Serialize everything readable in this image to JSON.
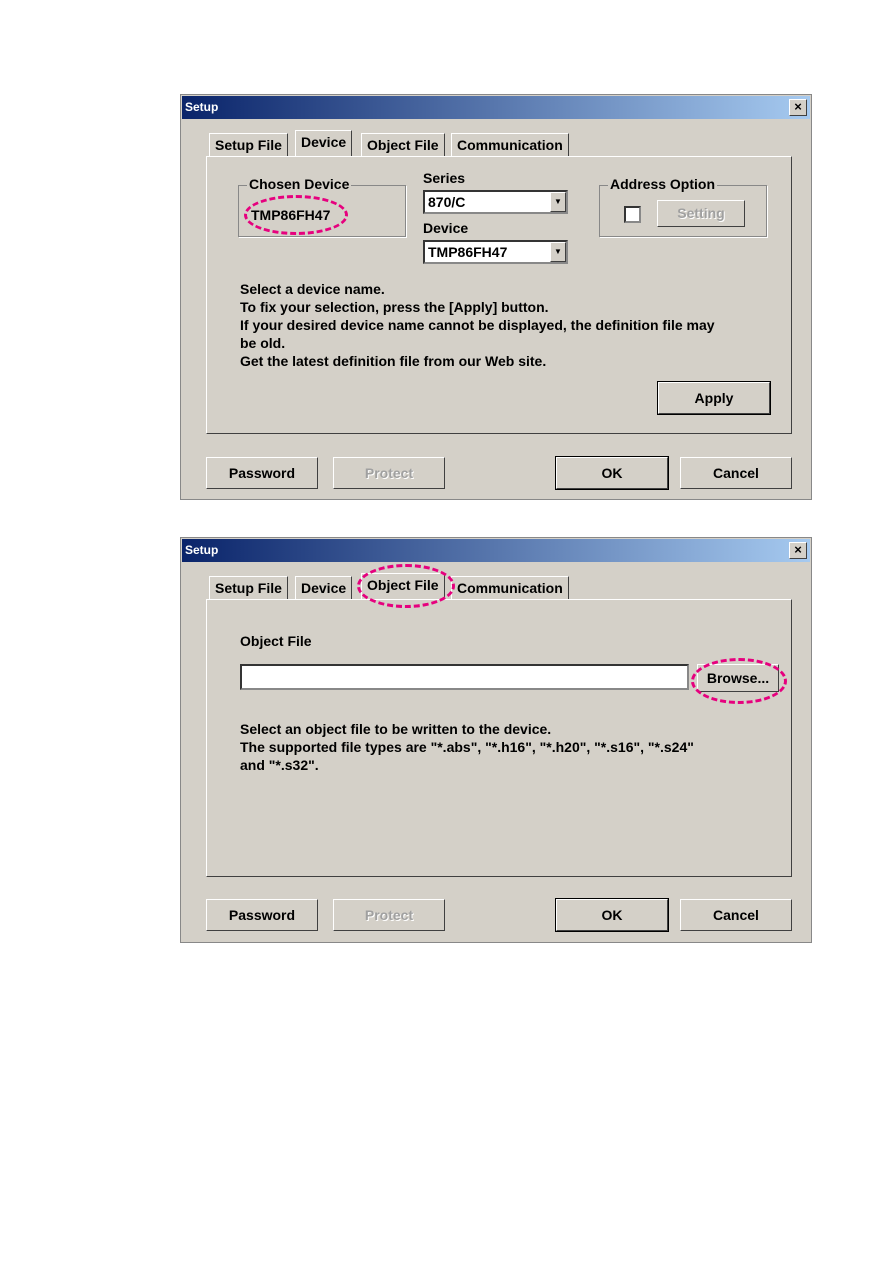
{
  "dialog_device": {
    "title": "Setup",
    "tabs": [
      "Setup File",
      "Device",
      "Object File",
      "Communication"
    ],
    "active_tab": "Device",
    "chosen_device_label": "Chosen Device",
    "chosen_device_value": "TMP86FH47",
    "series_label": "Series",
    "series_value": "870/C",
    "device_label": "Device",
    "device_value": "TMP86FH47",
    "address_option_label": "Address Option",
    "address_option_checked": false,
    "setting_button": "Setting",
    "instructions": [
      "Select a device name.",
      "To fix your selection, press the [Apply] button.",
      "If your desired device name cannot be displayed, the definition file may",
      "be old.",
      "Get the latest definition file from our Web site."
    ],
    "apply_button": "Apply",
    "buttons": {
      "password": "Password",
      "protect": "Protect",
      "ok": "OK",
      "cancel": "Cancel"
    }
  },
  "dialog_object": {
    "title": "Setup",
    "tabs": [
      "Setup File",
      "Device",
      "Object File",
      "Communication"
    ],
    "active_tab": "Object File",
    "object_file_label": "Object File",
    "object_file_value": "",
    "browse_button": "Browse...",
    "instructions": [
      "Select an object file to be written to the device.",
      "The supported file types are \"*.abs\", \"*.h16\", \"*.h20\", \"*.s16\", \"*.s24\"",
      "and \"*.s32\"."
    ],
    "buttons": {
      "password": "Password",
      "protect": "Protect",
      "ok": "OK",
      "cancel": "Cancel"
    }
  },
  "highlight_color": "#e6007e",
  "close_icon": "close-icon"
}
